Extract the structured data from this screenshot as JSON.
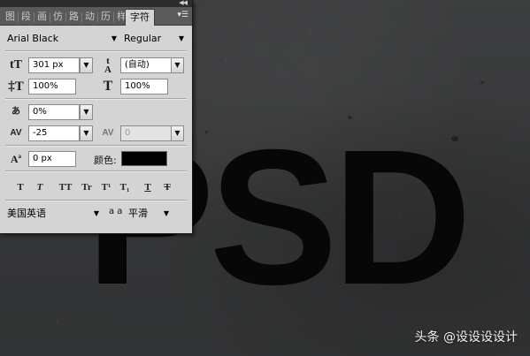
{
  "canvas": {
    "text": "PSD",
    "text_color": "#070707",
    "background_color": "#38393a"
  },
  "watermark": "头条 @设设设设计",
  "panel": {
    "tabs": [
      {
        "label": "图"
      },
      {
        "label": "段"
      },
      {
        "label": "画"
      },
      {
        "label": "仿"
      },
      {
        "label": "路"
      },
      {
        "label": "动"
      },
      {
        "label": "历"
      },
      {
        "label": "样"
      }
    ],
    "active_tab": "字符",
    "font_family": "Arial Black",
    "font_style": "Regular",
    "font_size": "301 px",
    "leading": "(自动)",
    "vertical_scale": "100%",
    "horizontal_scale": "100%",
    "tsume": "0%",
    "kerning": "-25",
    "tracking": "0",
    "baseline_shift": "0 px",
    "color_label": "颜色:",
    "color_value": "#000000",
    "language": "美国英语",
    "antialias_icon_text": "a a",
    "antialias": "平滑",
    "style_buttons": [
      {
        "name": "faux-bold",
        "text": "T"
      },
      {
        "name": "faux-italic",
        "text": "T"
      },
      {
        "name": "all-caps",
        "text": "TT"
      },
      {
        "name": "small-caps",
        "text": "Tr"
      },
      {
        "name": "superscript",
        "text": "T¹"
      },
      {
        "name": "subscript",
        "text": "T₁"
      },
      {
        "name": "underline",
        "text": "T"
      },
      {
        "name": "strikethrough",
        "text": "T"
      }
    ]
  }
}
